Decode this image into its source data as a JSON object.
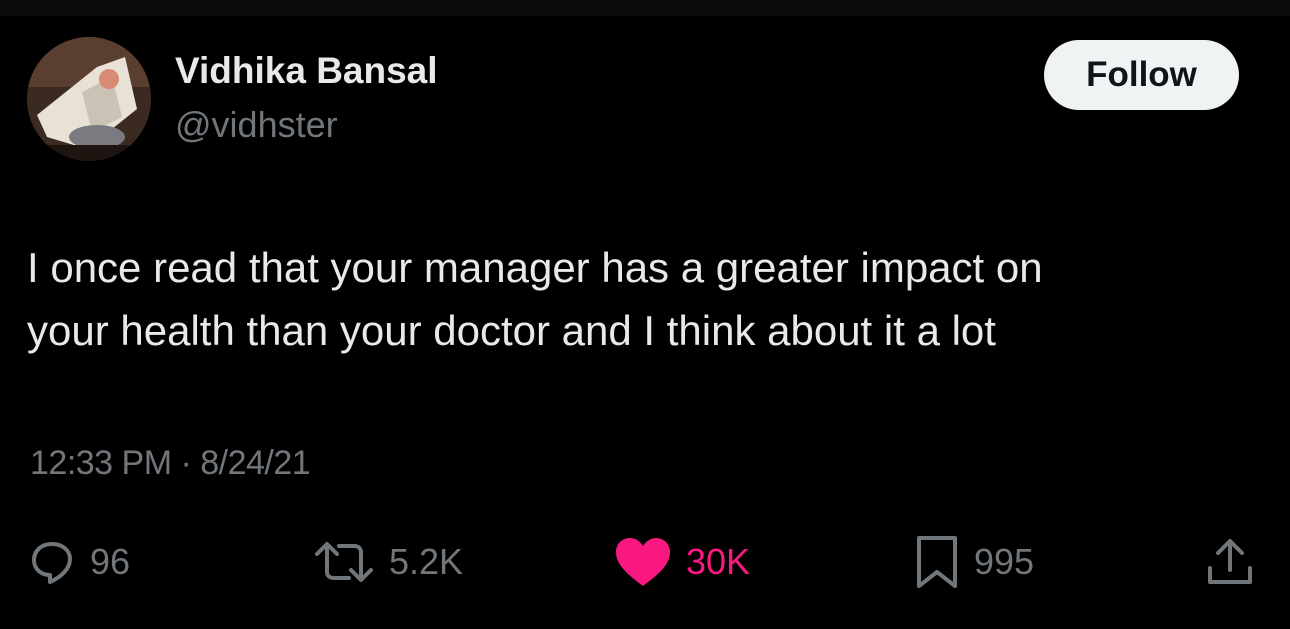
{
  "author": {
    "display_name": "Vidhika Bansal",
    "handle": "@vidhster"
  },
  "follow_label": "Follow",
  "tweet": {
    "text": "I once read that your manager has a greater impact on\nyour health than your doctor and I think about it a lot",
    "timestamp": "12:33 PM · 8/24/21"
  },
  "actions": {
    "replies": "96",
    "reposts": "5.2K",
    "likes": "30K",
    "bookmarks": "995"
  },
  "icons": {
    "reply": "speech-bubble-icon",
    "repost": "repost-arrows-icon",
    "like": "heart-icon",
    "bookmark": "bookmark-icon",
    "share": "share-upload-icon"
  },
  "colors": {
    "background": "#000000",
    "text_primary": "#e7e9ea",
    "text_secondary": "#71767b",
    "like_active": "#f91880",
    "follow_bg": "#eff3f4"
  }
}
